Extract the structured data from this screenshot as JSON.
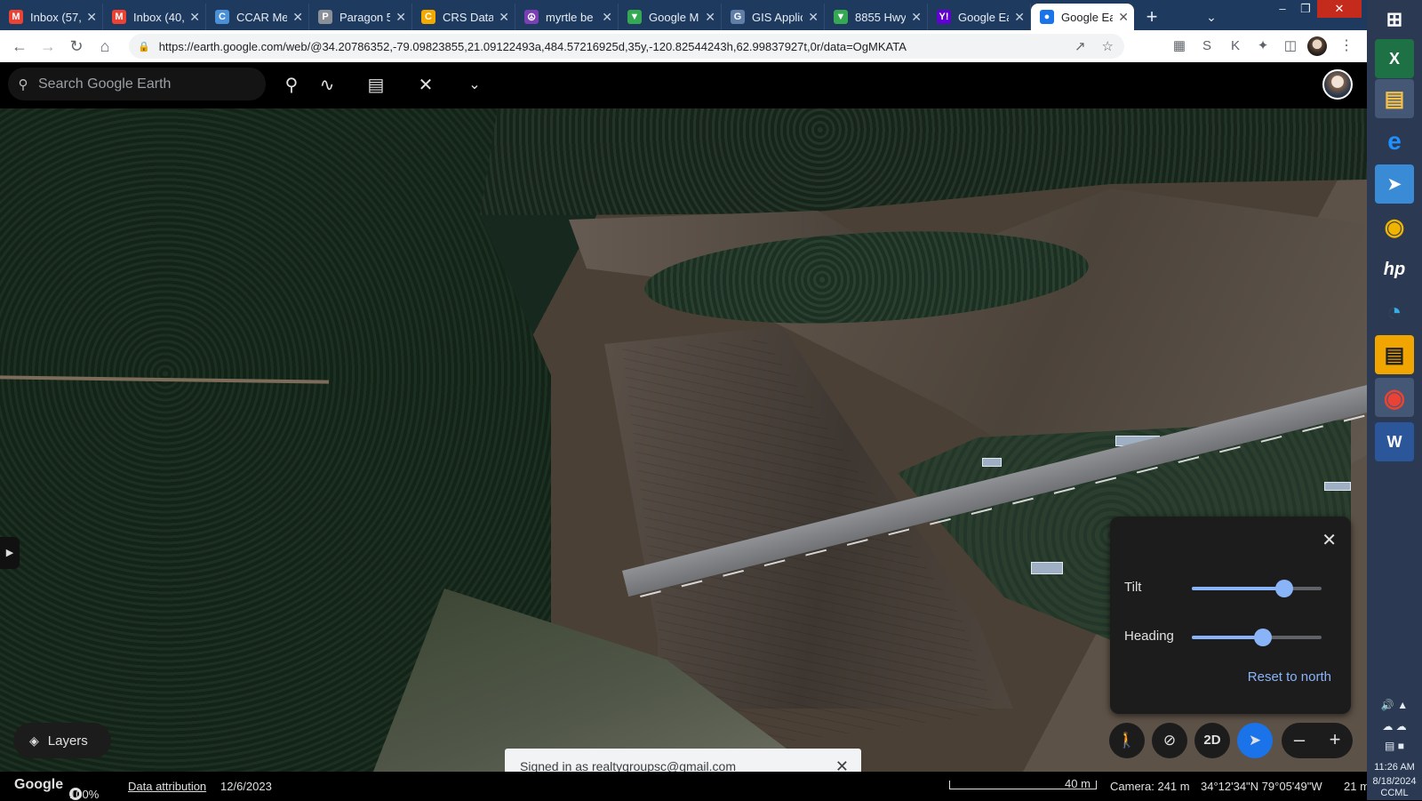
{
  "browser": {
    "tabs": [
      {
        "title": "Inbox (57,",
        "icon": "gmail-icon",
        "color": "#ea4335",
        "glyph": "M"
      },
      {
        "title": "Inbox (40,",
        "icon": "gmail-icon",
        "color": "#ea4335",
        "glyph": "M"
      },
      {
        "title": "CCAR Mer",
        "icon": "ccar-icon",
        "color": "#4a90d9",
        "glyph": "C"
      },
      {
        "title": "Paragon 5",
        "icon": "paragon-icon",
        "color": "#8a8f98",
        "glyph": "P"
      },
      {
        "title": "CRS Data",
        "icon": "crs-icon",
        "color": "#f2a900",
        "glyph": "C"
      },
      {
        "title": "myrtle be",
        "icon": "peace-icon",
        "color": "#7b3fb5",
        "glyph": "☮"
      },
      {
        "title": "Google M",
        "icon": "maps-icon",
        "color": "#34a853",
        "glyph": "▼"
      },
      {
        "title": "GIS Applic",
        "icon": "gis-icon",
        "color": "#5f7ea8",
        "glyph": "G"
      },
      {
        "title": "8855 Hwy",
        "icon": "maps-icon",
        "color": "#34a853",
        "glyph": "▼"
      },
      {
        "title": "Google Ea",
        "icon": "yahoo-icon",
        "color": "#6001d2",
        "glyph": "Y!"
      },
      {
        "title": "Google Ea",
        "icon": "earth-icon",
        "color": "#1a73e8",
        "glyph": "●",
        "active": true
      }
    ],
    "url": "https://earth.google.com/web/@34.20786352,-79.09823855,21.09122493a,484.57216925d,35y,-120.82544243h,62.99837927t,0r/data=OgMKATA"
  },
  "earth": {
    "search_placeholder": "Search Google Earth",
    "tilt_panel": {
      "tilt_label": "Tilt",
      "tilt_value": 0.71,
      "heading_label": "Heading",
      "heading_value": 0.55,
      "reset_label": "Reset to north"
    },
    "layers_label": "Layers",
    "mode_2d_label": "2D",
    "toast_text": "Signed in as realtygroupsc@gmail.com",
    "status": {
      "brand": "Google",
      "zoom": "100%",
      "attribution": "Data attribution",
      "imagery_date": "12/6/2023",
      "scale": "40 m",
      "camera": "Camera: 241 m",
      "coords": "34°12'34\"N 79°05'49\"W",
      "elevation": "21 m"
    }
  },
  "taskbar": {
    "time": "11:26 AM",
    "date": "8/18/2024",
    "ccml": "CCML"
  }
}
